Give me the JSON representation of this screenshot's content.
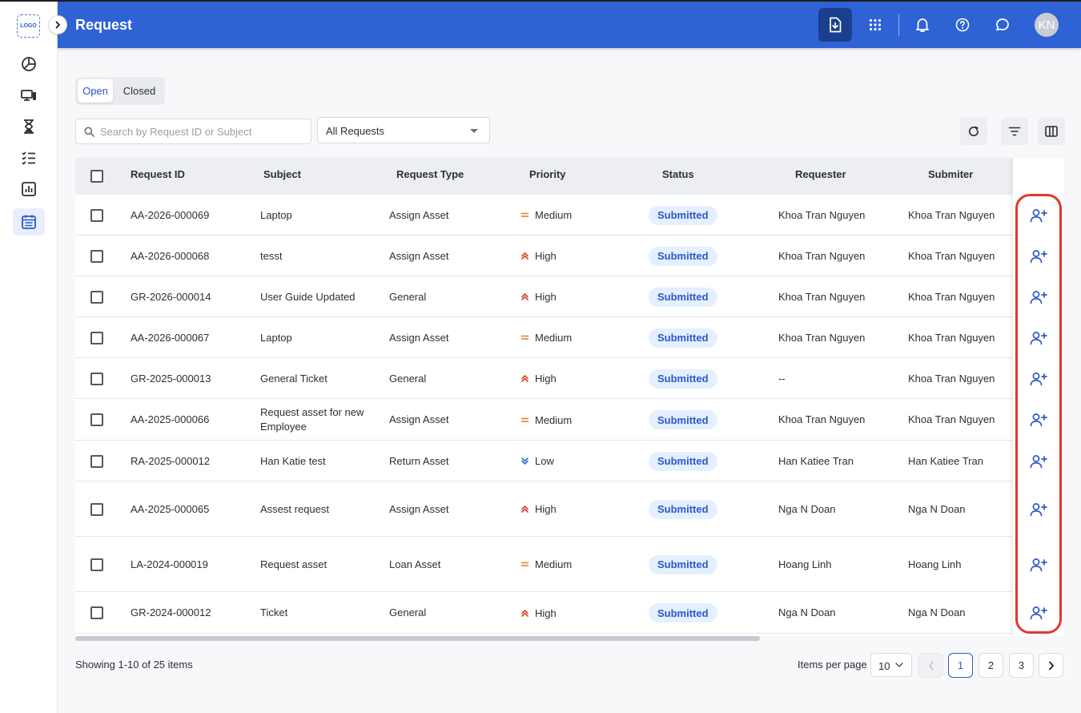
{
  "app": {
    "logo_text": "LOGO",
    "title": "Request",
    "avatar_initials": "KN"
  },
  "header_icons": [
    "download-doc-icon",
    "apps-grid-icon",
    "bell-icon",
    "help-icon",
    "chat-icon"
  ],
  "sidebar": {
    "items": [
      {
        "icon": "dashboard-icon",
        "active": false
      },
      {
        "icon": "devices-icon",
        "active": false
      },
      {
        "icon": "hourglass-icon",
        "active": false
      },
      {
        "icon": "checklist-icon",
        "active": false
      },
      {
        "icon": "report-chart-icon",
        "active": false
      },
      {
        "icon": "request-calendar-icon",
        "active": true
      }
    ]
  },
  "tabs": {
    "open": "Open",
    "closed": "Closed",
    "active": "Open"
  },
  "filters": {
    "search_placeholder": "Search by Request ID or Subject",
    "search_value": "",
    "type_select": "All Requests"
  },
  "table": {
    "columns": [
      "Request ID",
      "Subject",
      "Request Type",
      "Priority",
      "Status",
      "Requester",
      "Submiter"
    ],
    "rows": [
      {
        "id": "AA-2026-000069",
        "subject": "Laptop",
        "subject2": "",
        "type": "Assign Asset",
        "priority": "Medium",
        "status": "Submitted",
        "requester": "Khoa Tran Nguyen",
        "submiter": "Khoa Tran Nguyen"
      },
      {
        "id": "AA-2026-000068",
        "subject": "tesst",
        "subject2": "",
        "type": "Assign Asset",
        "priority": "High",
        "status": "Submitted",
        "requester": "Khoa Tran Nguyen",
        "submiter": "Khoa Tran Nguyen"
      },
      {
        "id": "GR-2026-000014",
        "subject": "User Guide Updated",
        "subject2": "",
        "type": "General",
        "priority": "High",
        "status": "Submitted",
        "requester": "Khoa Tran Nguyen",
        "submiter": "Khoa Tran Nguyen"
      },
      {
        "id": "AA-2026-000067",
        "subject": "Laptop",
        "subject2": "",
        "type": "Assign Asset",
        "priority": "Medium",
        "status": "Submitted",
        "requester": "Khoa Tran Nguyen",
        "submiter": "Khoa Tran Nguyen"
      },
      {
        "id": "GR-2025-000013",
        "subject": "General Ticket",
        "subject2": "",
        "type": "General",
        "priority": "High",
        "status": "Submitted",
        "requester": "--",
        "submiter": "Khoa Tran Nguyen"
      },
      {
        "id": "AA-2025-000066",
        "subject": "Request asset for new",
        "subject2": "Employee",
        "type": "Assign Asset",
        "priority": "Medium",
        "status": "Submitted",
        "requester": "Khoa Tran Nguyen",
        "submiter": "Khoa Tran Nguyen"
      },
      {
        "id": "RA-2025-000012",
        "subject": "Han Katie test",
        "subject2": "",
        "type": "Return Asset",
        "priority": "Low",
        "status": "Submitted",
        "requester": "Han Katiee Tran",
        "submiter": "Han Katiee Tran"
      },
      {
        "id": "AA-2025-000065",
        "subject": "Assest request",
        "subject2": "",
        "type": "Assign Asset",
        "priority": "High",
        "status": "Submitted",
        "requester": "Nga N Doan",
        "submiter": "Nga N Doan"
      },
      {
        "id": "LA-2024-000019",
        "subject": "Request asset",
        "subject2": "",
        "type": "Loan Asset",
        "priority": "Medium",
        "status": "Submitted",
        "requester": "Hoang Linh",
        "submiter": "Hoang Linh"
      },
      {
        "id": "GR-2024-000012",
        "subject": "Ticket",
        "subject2": "",
        "type": "General",
        "priority": "High",
        "status": "Submitted",
        "requester": "Nga N Doan",
        "submiter": "Nga N Doan"
      }
    ],
    "row_action_icon": "assign-user-plus-icon"
  },
  "footer": {
    "showing": "Showing 1-10 of 25 items",
    "items_per_page_label": "Items per page",
    "items_per_page_value": "10",
    "pages": [
      "1",
      "2",
      "3"
    ],
    "current_page": "1"
  },
  "colors": {
    "header_blue": "#2f62d4",
    "accent_blue": "#2c58c9",
    "priority_high": "#d9402b",
    "priority_medium": "#e07a1f",
    "priority_low": "#2c6fd0",
    "highlight_red": "#e03a2a"
  }
}
